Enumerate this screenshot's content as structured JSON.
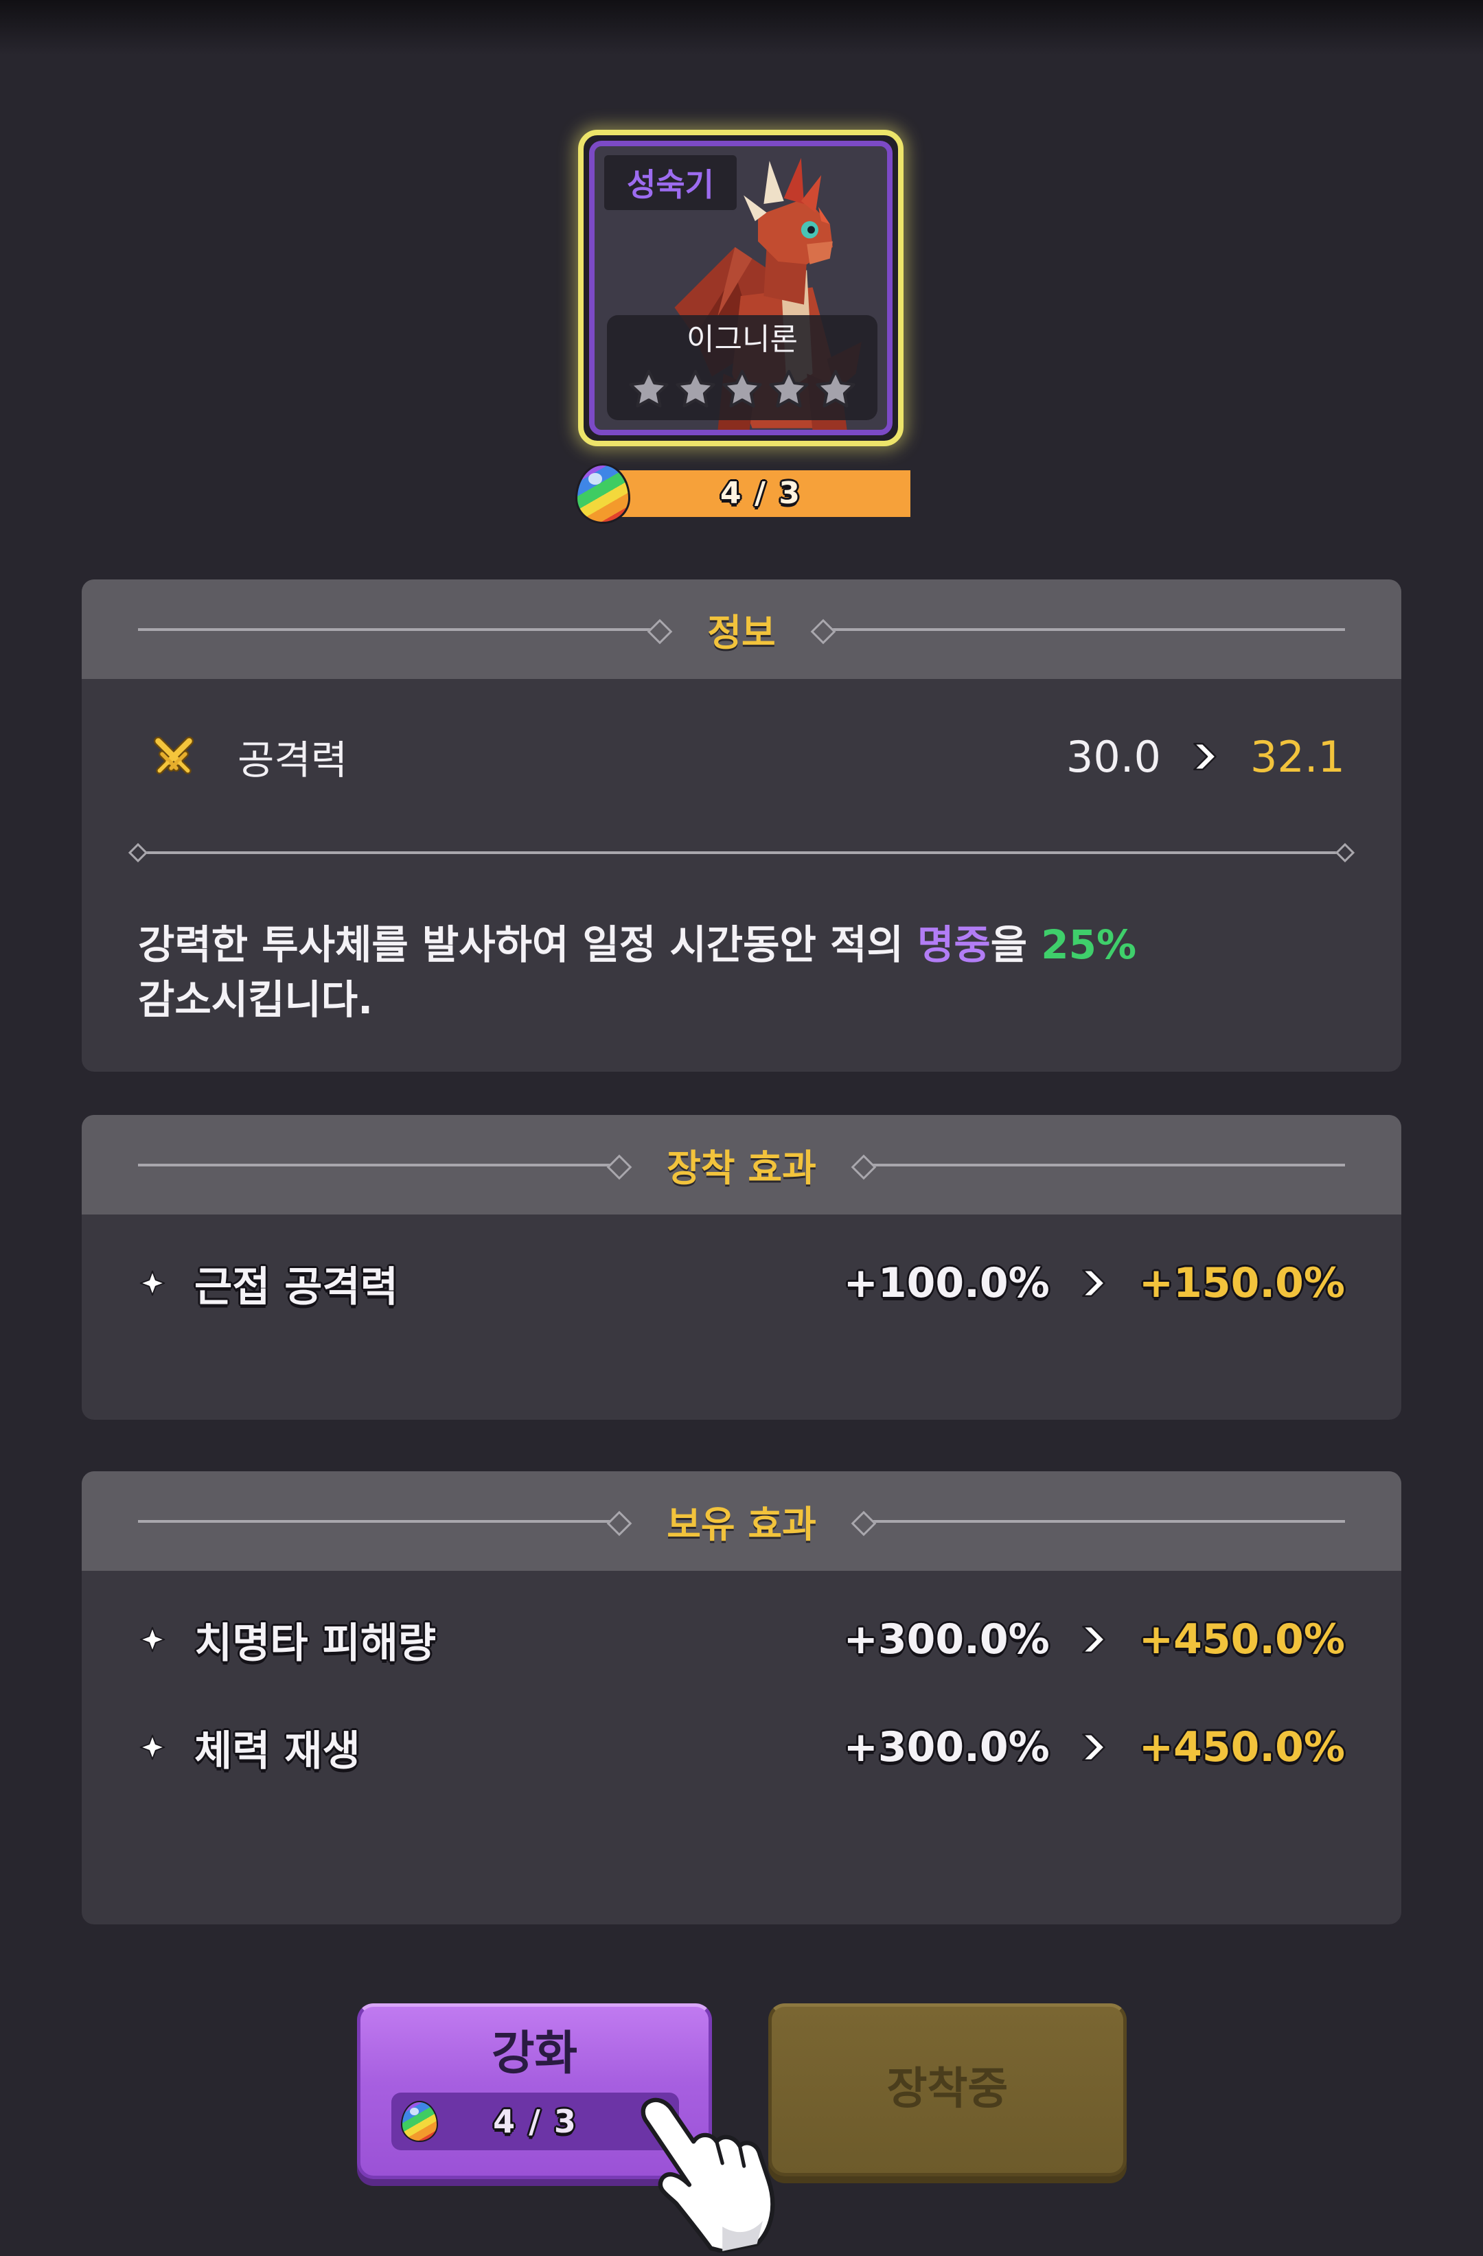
{
  "pet": {
    "stage_label": "성숙기",
    "name": "이그니론",
    "stars_total": 5,
    "stars_filled": 0,
    "progress_text": "4 / 3",
    "progress_fraction": 1,
    "progress_icon": "rainbow-egg-icon"
  },
  "info_panel": {
    "title": "정보",
    "stat": {
      "icon": "crossed-swords-icon",
      "label": "공격력",
      "current": "30.0",
      "next": "32.1"
    },
    "description": {
      "text_before": "강력한 투사체를 발사하여 일정 시간동안 적의 ",
      "keyword": "명중",
      "text_middle": "을 ",
      "value": "25%",
      "text_after": "감소시킵니다."
    }
  },
  "equip_panel": {
    "title": "장착 효과",
    "effects": [
      {
        "label": "근접 공격력",
        "current": "+100.0%",
        "next": "+150.0%"
      }
    ]
  },
  "possession_panel": {
    "title": "보유 효과",
    "effects": [
      {
        "label": "치명타 피해량",
        "current": "+300.0%",
        "next": "+450.0%"
      },
      {
        "label": "체력 재생",
        "current": "+300.0%",
        "next": "+450.0%"
      }
    ]
  },
  "buttons": {
    "enhance": {
      "label": "강화",
      "cost_text": "4 / 3",
      "cost_icon": "rainbow-egg-icon"
    },
    "equipped": {
      "label": "장착중"
    }
  },
  "icons": {
    "bullet": "four-point-star-icon",
    "change_arrow": "arrow-right-icon",
    "tutorial_pointer": "pointing-hand-icon"
  },
  "colors": {
    "background": "#28262e",
    "accent_gold": "#f2c33c",
    "keyword_purple": "#b27df5",
    "value_green": "#3fcf6b",
    "stage_purple": "#9d6cf0",
    "progress_orange": "#f6a13a",
    "enhance_purple": "#a75fe0",
    "equipped_brown": "#6d5b2b",
    "card_glow_yellow": "#ede46a"
  }
}
